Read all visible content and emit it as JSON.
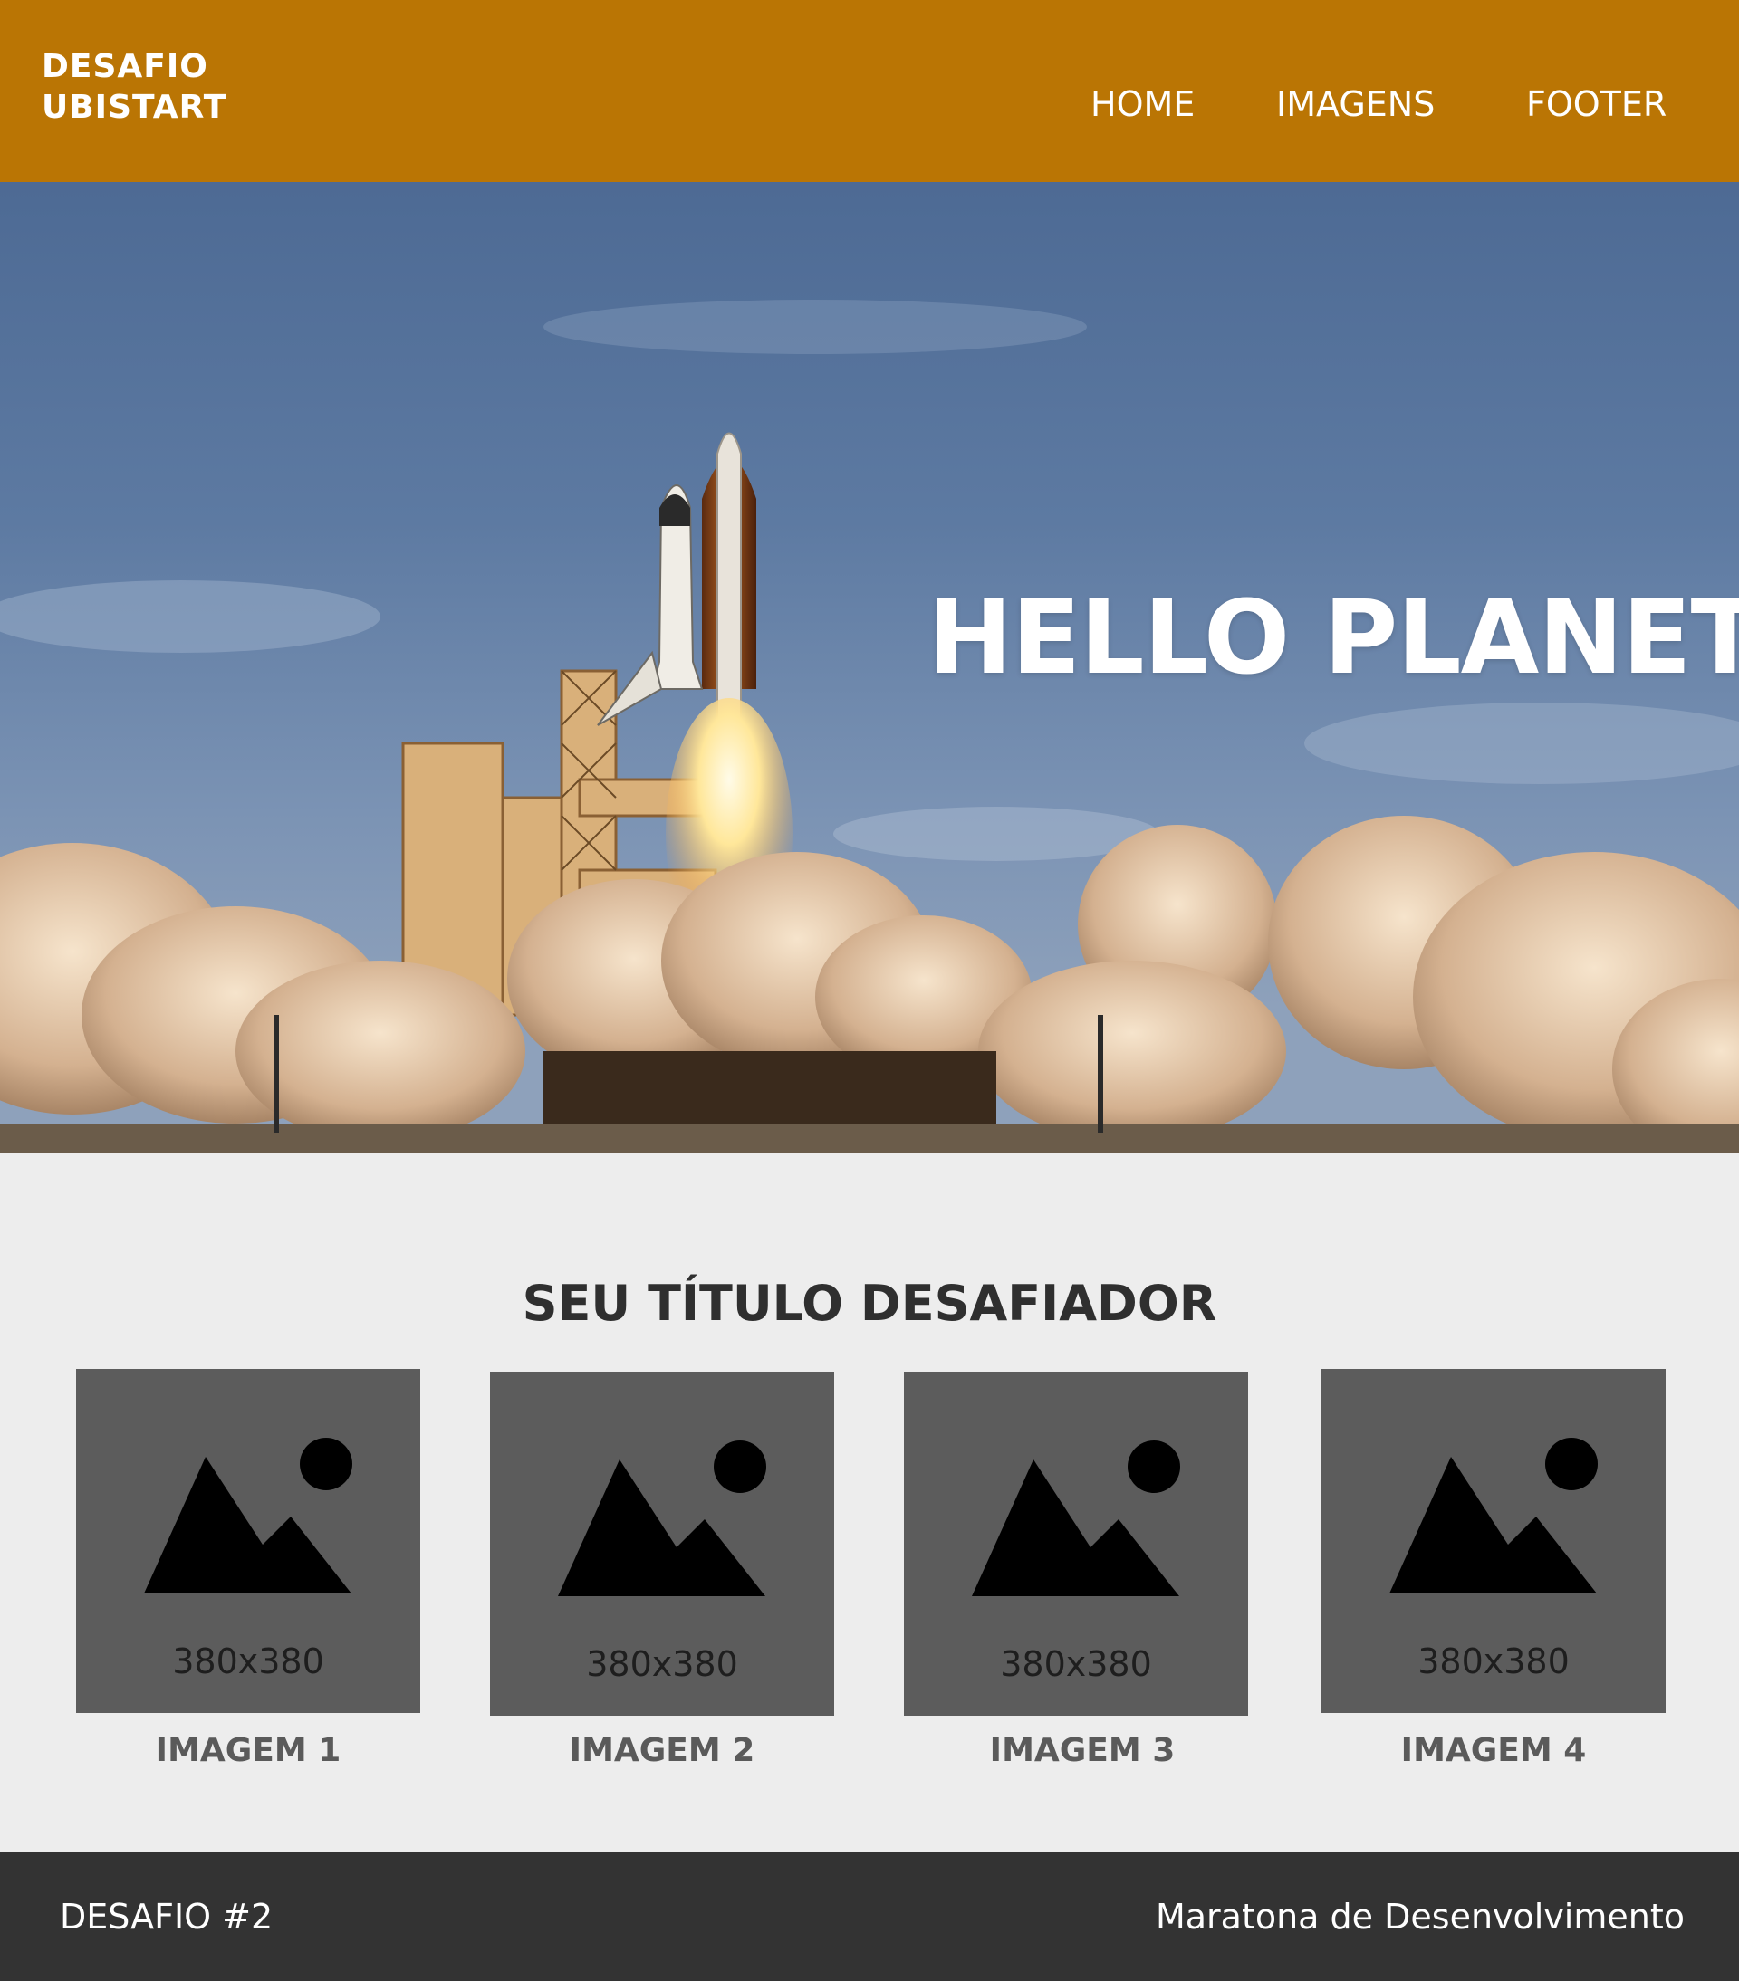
{
  "header": {
    "logo_line1": "DESAFIO",
    "logo_line2": "UBISTART",
    "nav": {
      "home": "HOME",
      "imagens": "IMAGENS",
      "footer": "FOOTER"
    },
    "background_color": "#ba7504"
  },
  "hero": {
    "title": "HELLO PLANET",
    "image": "rocket-launch-photo"
  },
  "main": {
    "title": "SEU TÍTULO DESAFIADOR",
    "cards": [
      {
        "placeholder_size": "380x380",
        "label": "IMAGEM 1",
        "icon": "image-placeholder-icon"
      },
      {
        "placeholder_size": "380x380",
        "label": "IMAGEM 2",
        "icon": "image-placeholder-icon"
      },
      {
        "placeholder_size": "380x380",
        "label": "IMAGEM 3",
        "icon": "image-placeholder-icon"
      },
      {
        "placeholder_size": "380x380",
        "label": "IMAGEM 4",
        "icon": "image-placeholder-icon"
      }
    ]
  },
  "footer": {
    "left": "DESAFIO #2",
    "right": "Maratona de Desenvolvimento",
    "background_color": "#333333"
  }
}
